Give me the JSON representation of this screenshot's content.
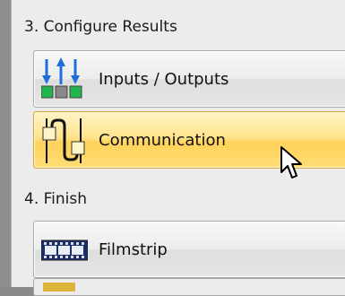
{
  "sections": [
    {
      "title": "3. Configure Results"
    },
    {
      "title": "4. Finish"
    }
  ],
  "items": [
    {
      "label": "Inputs / Outputs",
      "icon": "inputs-outputs-icon"
    },
    {
      "label": "Communication",
      "icon": "communication-icon",
      "state": "hovered"
    },
    {
      "label": "Filmstrip",
      "icon": "filmstrip-icon"
    }
  ],
  "colors": {
    "active_bg": "#ffd35a",
    "input_arrow": "#1f6fd8",
    "output_square": "#20b64a"
  }
}
